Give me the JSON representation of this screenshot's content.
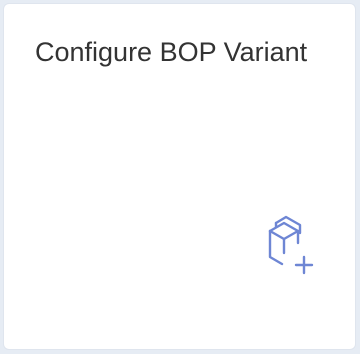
{
  "tile": {
    "title": "Configure BOP Variant",
    "icon": "configure-bop-variant-icon",
    "accent_color": "#6e86d4"
  }
}
